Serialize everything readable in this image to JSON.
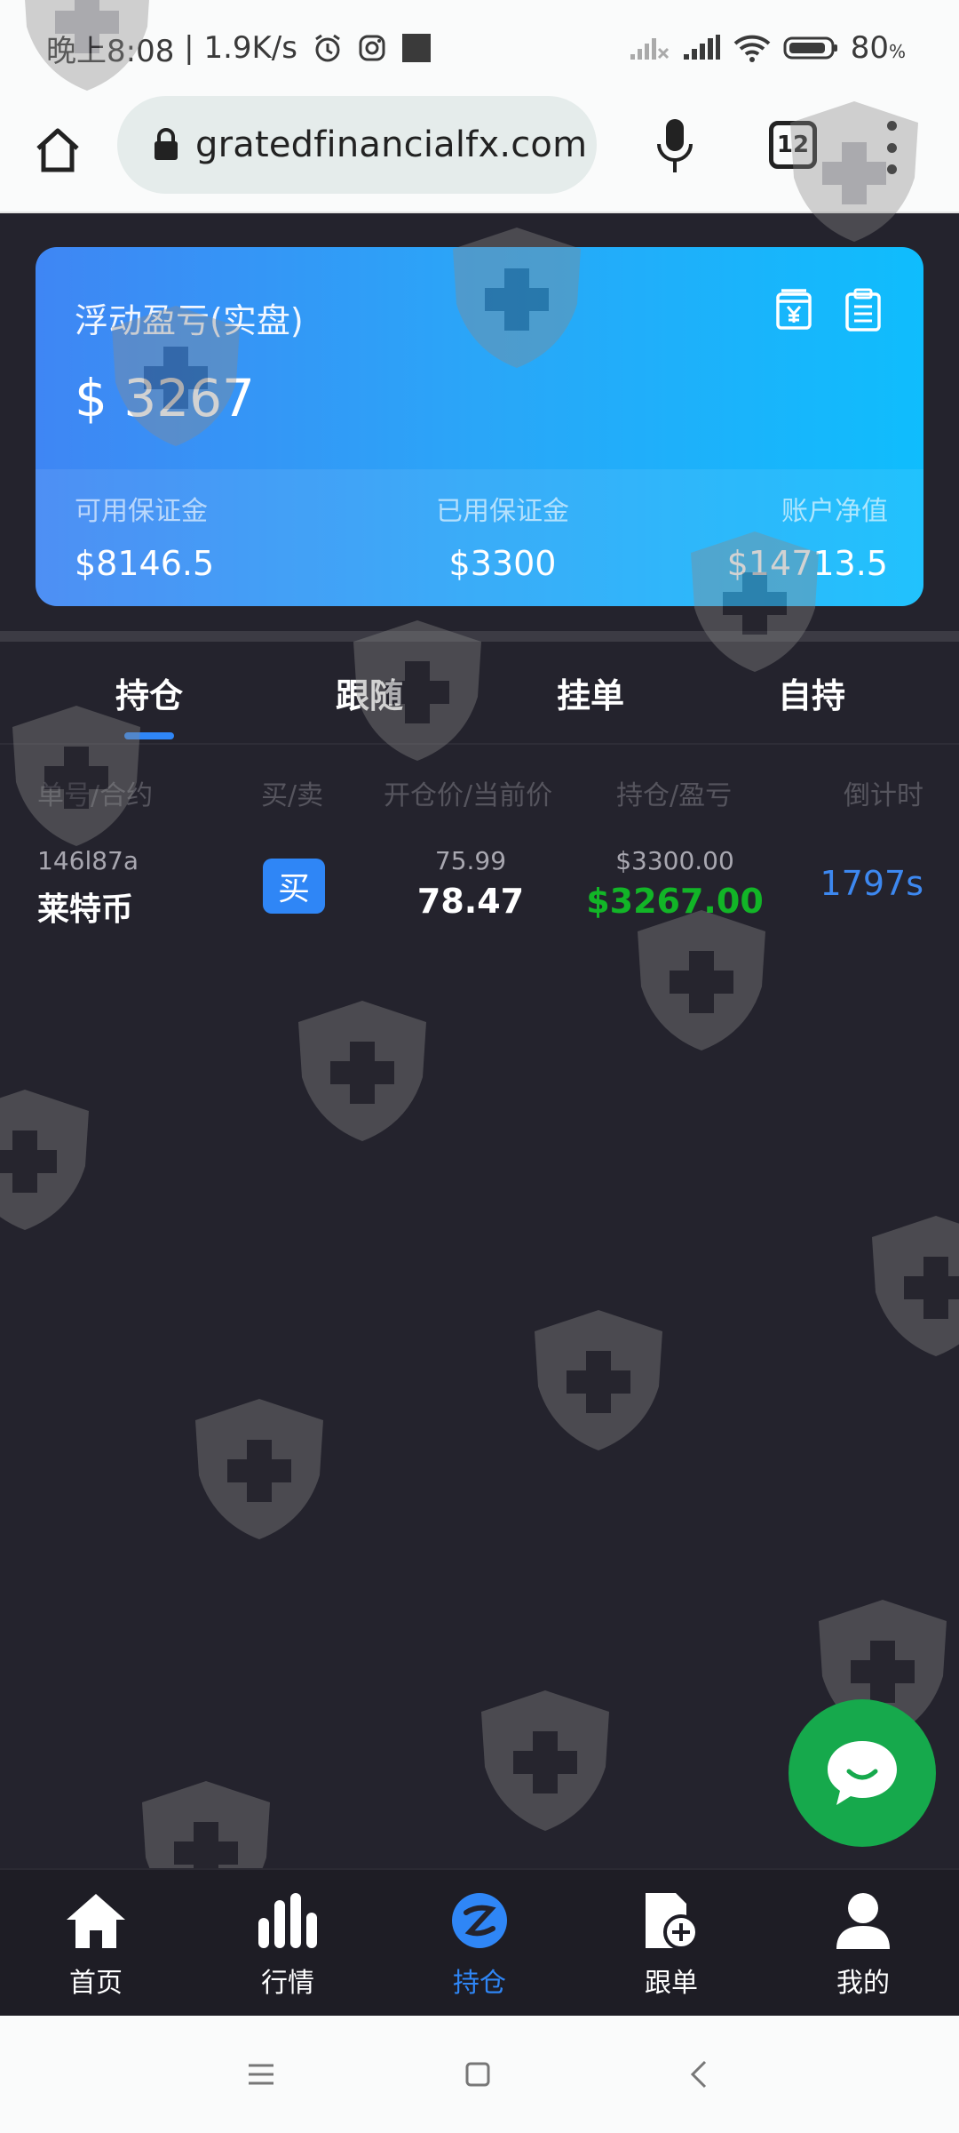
{
  "status_bar": {
    "time": "晚上8:08",
    "speed": "1.9K/s",
    "battery": "80",
    "battery_unit": "%"
  },
  "browser": {
    "url": "gratedfinancialfx.com",
    "tab_count": "12"
  },
  "summary": {
    "title": "浮动盈亏(实盘)",
    "amount": "$ 3267",
    "stats": [
      {
        "label": "可用保证金",
        "value": "$8146.5"
      },
      {
        "label": "已用保证金",
        "value": "$3300"
      },
      {
        "label": "账户净值",
        "value": "$14713.5"
      }
    ]
  },
  "tabs": [
    "持仓",
    "跟随",
    "挂单",
    "自持"
  ],
  "active_tab": "持仓",
  "table": {
    "headers": [
      "单号/合约",
      "买/卖",
      "开仓价/当前价",
      "持仓/盈亏",
      "倒计时"
    ],
    "rows": [
      {
        "order_id": "146l87a",
        "contract": "莱特币",
        "side": "买",
        "open_price": "75.99",
        "current_price": "78.47",
        "position": "$3300.00",
        "pnl": "$3267.00",
        "countdown": "1797s"
      }
    ]
  },
  "bottom_nav": [
    {
      "label": "首页",
      "icon": "home-icon"
    },
    {
      "label": "行情",
      "icon": "bar-chart-icon"
    },
    {
      "label": "持仓",
      "icon": "position-icon"
    },
    {
      "label": "跟单",
      "icon": "copy-order-icon"
    },
    {
      "label": "我的",
      "icon": "user-icon"
    }
  ],
  "colors": {
    "accent": "#2f86f6",
    "profit": "#12b527",
    "background": "#24232d",
    "chat": "#16a94c"
  }
}
